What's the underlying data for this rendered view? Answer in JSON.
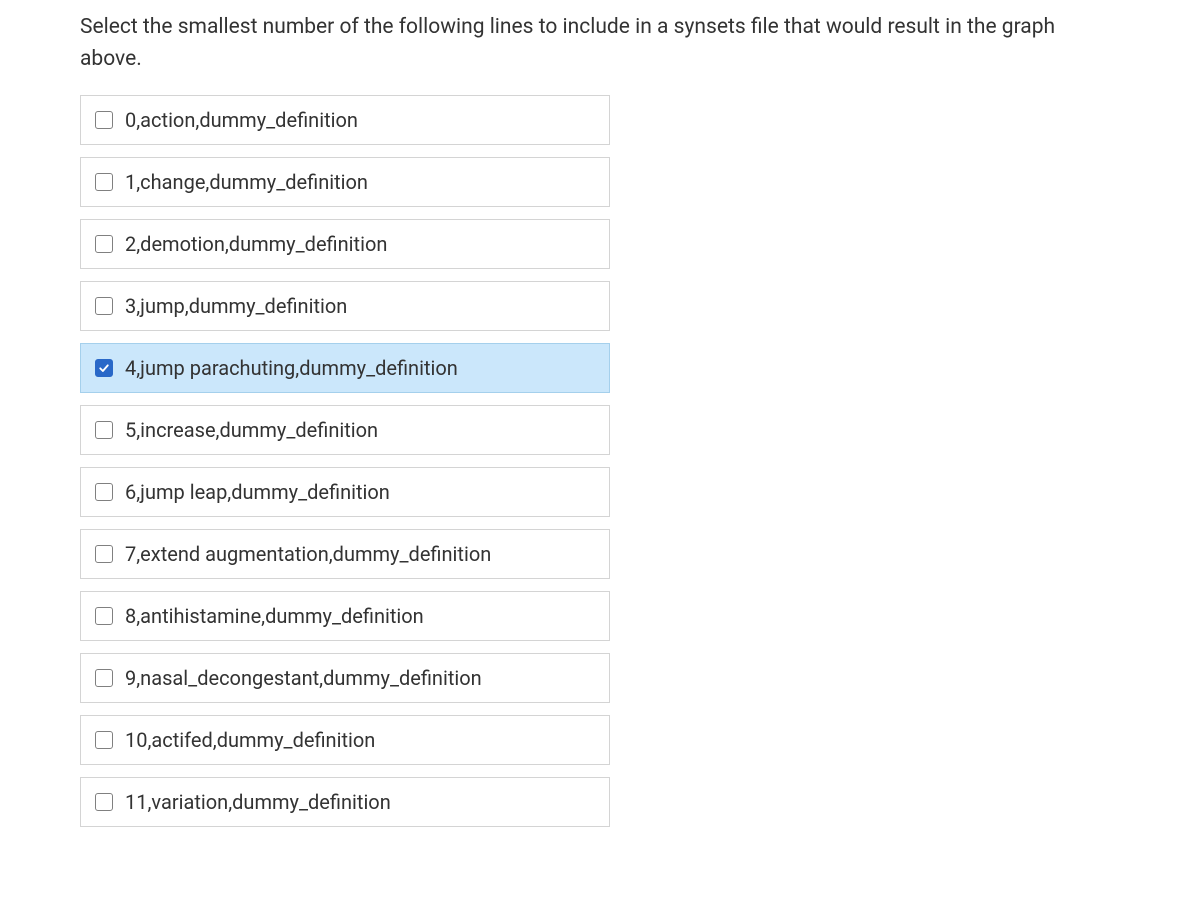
{
  "question": "Select the smallest number of the following lines to include in a synsets file that would result in the graph above.",
  "options": [
    {
      "label": "0,action,dummy_definition",
      "checked": false
    },
    {
      "label": "1,change,dummy_definition",
      "checked": false
    },
    {
      "label": "2,demotion,dummy_definition",
      "checked": false
    },
    {
      "label": "3,jump,dummy_definition",
      "checked": false
    },
    {
      "label": "4,jump parachuting,dummy_definition",
      "checked": true
    },
    {
      "label": "5,increase,dummy_definition",
      "checked": false
    },
    {
      "label": "6,jump leap,dummy_definition",
      "checked": false
    },
    {
      "label": "7,extend augmentation,dummy_definition",
      "checked": false
    },
    {
      "label": "8,antihistamine,dummy_definition",
      "checked": false
    },
    {
      "label": "9,nasal_decongestant,dummy_definition",
      "checked": false
    },
    {
      "label": "10,actifed,dummy_definition",
      "checked": false
    },
    {
      "label": "11,variation,dummy_definition",
      "checked": false
    }
  ]
}
